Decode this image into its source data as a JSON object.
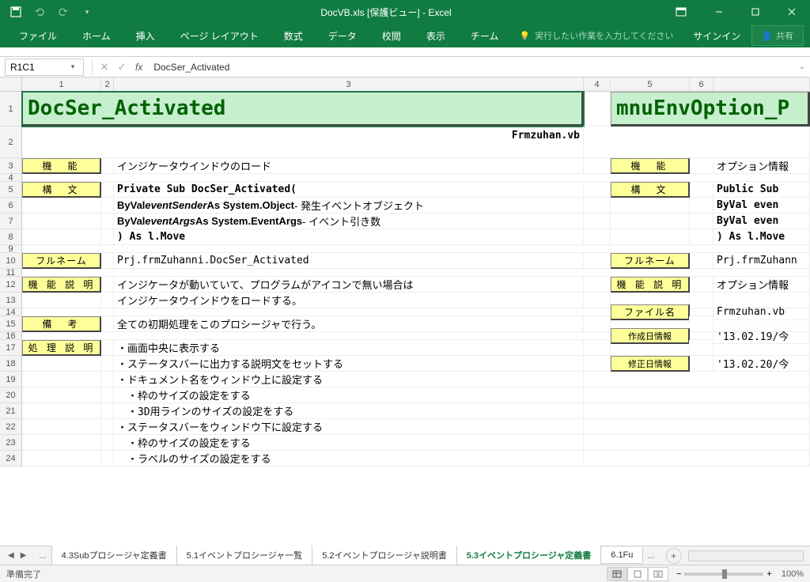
{
  "app": {
    "title": "DocVB.xls [保護ビュー] - Excel",
    "signin": "サインイン",
    "share": "共有",
    "tellme": "実行したい作業を入力してください"
  },
  "ribbon": {
    "tabs": [
      "ファイル",
      "ホーム",
      "挿入",
      "ページ レイアウト",
      "数式",
      "データ",
      "校閲",
      "表示",
      "チーム"
    ]
  },
  "formula": {
    "namebox": "R1C1",
    "value": "DocSer_Activated"
  },
  "cols": [
    "1",
    "2",
    "3",
    "4",
    "5",
    "6"
  ],
  "rows_left": {
    "title": "DocSer_Activated",
    "filename": "Frmzuhan.vb",
    "labels": {
      "kinou": "機　能",
      "koubun": "構　文",
      "fullname": "フルネーム",
      "setsumei": "機 能 説 明",
      "bikou": "備　考",
      "shori": "処 理 説 明"
    },
    "r3": "インジケータウインドウのロード",
    "r5": "Private Sub DocSer_Activated(",
    "r6a": "  ByVal ",
    "r6b": "eventSender",
    "r6c": "  As System.Object   ",
    "r6d": "- 発生イベントオブジェクト",
    "r7a": "  ByVal ",
    "r7b": "eventArgs",
    "r7c": "   As System.EventArgs ",
    "r7d": "- イベント引き数",
    "r8": ") As l.Move",
    "r10": "Prj.frmZuhanni.DocSer_Activated",
    "r12": "インジケータが動いていて、プログラムがアイコンで無い場合は",
    "r13": "インジケータウインドウをロードする。",
    "r15": "全ての初期処理をこのプロシージャで行う。",
    "r17": "・画面中央に表示する",
    "r18": "・ステータスバーに出力する説明文をセットする",
    "r19": "・ドキュメント名をウィンドウ上に設定する",
    "r20": "　・枠のサイズの設定をする",
    "r21": "　・3D用ラインのサイズの設定をする",
    "r22": "・ステータスバーをウィンドウ下に設定する",
    "r23": "　・枠のサイズの設定をする",
    "r24": "　・ラベルのサイズの設定をする"
  },
  "rows_right": {
    "title": "mnuEnvOption_P",
    "labels": {
      "kinou": "機　能",
      "koubun": "構　文",
      "fullname": "フルネーム",
      "setsumei": "機 能 説 明",
      "filename": "ファイル名",
      "created": "作成日情報",
      "modified": "修正日情報"
    },
    "r3": "オプション情報",
    "r5": "Public Sub ",
    "r6": "  ByVal even",
    "r7": "  ByVal even",
    "r8": ") As l.Move",
    "r10": "Prj.frmZuhann",
    "r12": "オプション情報",
    "r14": "Frmzuhan.vb",
    "r16": "'13.02.19/今",
    "r18": "'13.02.20/今"
  },
  "tabs": {
    "list": [
      "4.3Subプロシージャ定義書",
      "5.1イベントプロシージャ一覧",
      "5.2イベントプロシージャ説明書",
      "5.3イベントプロシージャ定義書",
      "6.1Fu"
    ],
    "active": 3,
    "dots": "...",
    "dots2": "..."
  },
  "status": {
    "ready": "準備完了",
    "zoom": "100%"
  }
}
